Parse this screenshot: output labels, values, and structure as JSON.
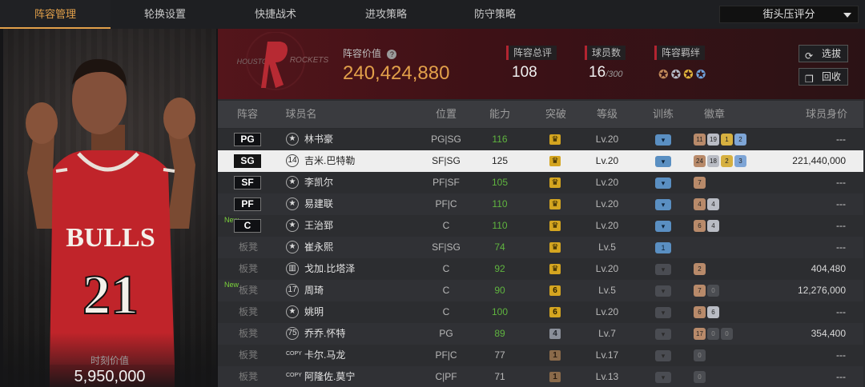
{
  "tabs": [
    {
      "label": "阵容管理"
    },
    {
      "label": "轮换设置"
    },
    {
      "label": "快捷战术"
    },
    {
      "label": "进攻策略"
    },
    {
      "label": "防守策略"
    }
  ],
  "dropdown": {
    "value": "街头压评分"
  },
  "player_panel": {
    "jersey_team": "BULLS",
    "jersey_number": "21",
    "value_title": "时刻价值",
    "value": "5,950,000"
  },
  "team": {
    "logo_left": "HOUSTON",
    "logo_right": "ROCKETS"
  },
  "header": {
    "lineup_value_label": "阵容价值",
    "lineup_value": "240,424,880",
    "total_rating_label": "阵容总评",
    "total_rating": "108",
    "player_count_label": "球员数",
    "player_count": "16",
    "player_count_max": "/300",
    "chemistry_label": "阵容羁绊",
    "select_button": "选拔",
    "recycle_button": "回收"
  },
  "columns": [
    "阵容",
    "球员名",
    "位置",
    "能力",
    "突破",
    "等级",
    "训练",
    "徽章",
    "球员身价"
  ],
  "rows": [
    {
      "slot": "PG",
      "bench": false,
      "new": false,
      "icon": "★",
      "name": "林书豪",
      "position": "PG|SG",
      "ability": "116",
      "ability_green": true,
      "breakthrough": "♛",
      "bt_color": "gold",
      "level": "Lv.20",
      "training": "blue",
      "badges": [
        [
          "b",
          "11"
        ],
        [
          "s",
          "19"
        ],
        [
          "g",
          "1"
        ],
        [
          "h",
          "2"
        ]
      ],
      "price": "---",
      "selected": false
    },
    {
      "slot": "SG",
      "bench": false,
      "new": false,
      "icon": "14",
      "name": "吉米.巴特勒",
      "position": "SF|SG",
      "ability": "125",
      "ability_green": false,
      "breakthrough": "♛",
      "bt_color": "gold",
      "level": "Lv.20",
      "training": "blue",
      "badges": [
        [
          "b",
          "24"
        ],
        [
          "s",
          "18"
        ],
        [
          "g",
          "2"
        ],
        [
          "h",
          "3"
        ]
      ],
      "price": "221,440,000",
      "selected": true
    },
    {
      "slot": "SF",
      "bench": false,
      "new": false,
      "icon": "★",
      "name": "李凯尔",
      "position": "PF|SF",
      "ability": "105",
      "ability_green": true,
      "breakthrough": "♛",
      "bt_color": "gold",
      "level": "Lv.20",
      "training": "blue",
      "badges": [
        [
          "b",
          "7"
        ]
      ],
      "price": "---",
      "selected": false
    },
    {
      "slot": "PF",
      "bench": false,
      "new": false,
      "icon": "★",
      "name": "易建联",
      "position": "PF|C",
      "ability": "110",
      "ability_green": true,
      "breakthrough": "♛",
      "bt_color": "gold",
      "level": "Lv.20",
      "training": "blue",
      "badges": [
        [
          "b",
          "4"
        ],
        [
          "s",
          "4"
        ]
      ],
      "price": "---",
      "selected": false
    },
    {
      "slot": "C",
      "bench": false,
      "new": true,
      "icon": "★",
      "name": "王治郅",
      "position": "C",
      "ability": "110",
      "ability_green": true,
      "breakthrough": "♛",
      "bt_color": "gold",
      "level": "Lv.20",
      "training": "blue",
      "badges": [
        [
          "b",
          "6"
        ],
        [
          "s",
          "4"
        ]
      ],
      "price": "---",
      "selected": false
    },
    {
      "slot": "板凳",
      "bench": true,
      "new": false,
      "icon": "★",
      "name": "崔永熙",
      "position": "SF|SG",
      "ability": "74",
      "ability_green": true,
      "breakthrough": "♛",
      "bt_color": "gold",
      "level": "Lv.5",
      "training": "blue1",
      "badges": [],
      "price": "---",
      "selected": false
    },
    {
      "slot": "板凳",
      "bench": true,
      "new": false,
      "icon": "▥",
      "name": "戈加.比塔泽",
      "position": "C",
      "ability": "92",
      "ability_green": true,
      "breakthrough": "♛",
      "bt_color": "gold",
      "level": "Lv.20",
      "training": "dark",
      "badges": [
        [
          "b",
          "2"
        ]
      ],
      "price": "404,480",
      "selected": false
    },
    {
      "slot": "板凳",
      "bench": true,
      "new": true,
      "icon": "17",
      "name": "周琦",
      "position": "C",
      "ability": "90",
      "ability_green": true,
      "breakthrough": "6",
      "bt_color": "gold",
      "level": "Lv.5",
      "training": "dark",
      "badges": [
        [
          "b",
          "7"
        ],
        [
          "x",
          "0"
        ]
      ],
      "price": "12,276,000",
      "selected": false
    },
    {
      "slot": "板凳",
      "bench": true,
      "new": false,
      "icon": "★",
      "name": "姚明",
      "position": "C",
      "ability": "100",
      "ability_green": true,
      "breakthrough": "6",
      "bt_color": "gold",
      "level": "Lv.20",
      "training": "dark",
      "badges": [
        [
          "b",
          "6"
        ],
        [
          "s",
          "6"
        ]
      ],
      "price": "---",
      "selected": false
    },
    {
      "slot": "板凳",
      "bench": true,
      "new": false,
      "icon": "75",
      "name": "乔乔.怀特",
      "position": "PG",
      "ability": "89",
      "ability_green": true,
      "breakthrough": "4",
      "bt_color": "gray",
      "level": "Lv.7",
      "training": "dark",
      "badges": [
        [
          "b",
          "17"
        ],
        [
          "x",
          "0"
        ],
        [
          "x",
          "0"
        ]
      ],
      "price": "354,400",
      "selected": false
    },
    {
      "slot": "板凳",
      "bench": true,
      "new": false,
      "icon": "COPY",
      "name": "卡尔.马龙",
      "position": "PF|C",
      "ability": "77",
      "ability_green": false,
      "breakthrough": "1",
      "bt_color": "brown",
      "level": "Lv.17",
      "training": "dark",
      "badges": [
        [
          "x",
          "0"
        ]
      ],
      "price": "---",
      "selected": false
    },
    {
      "slot": "板凳",
      "bench": true,
      "new": false,
      "icon": "COPY",
      "name": "阿隆佐.莫宁",
      "position": "C|PF",
      "ability": "71",
      "ability_green": false,
      "breakthrough": "1",
      "bt_color": "brown",
      "level": "Lv.13",
      "training": "dark",
      "badges": [
        [
          "x",
          "0"
        ]
      ],
      "price": "---",
      "selected": false
    }
  ],
  "new_label": "New"
}
